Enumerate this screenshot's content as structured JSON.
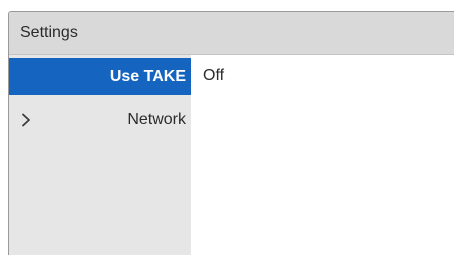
{
  "window": {
    "title": "Settings"
  },
  "sidebar": {
    "items": [
      {
        "label": "Use TAKE",
        "selected": true
      },
      {
        "label": "Network",
        "selected": false,
        "icon": "chevron-right-icon"
      }
    ]
  },
  "content": {
    "value": "Off"
  },
  "colors": {
    "selection": "#1565c0",
    "sidebar_bg": "#e6e6e6",
    "titlebar_bg": "#d9d9d9"
  }
}
